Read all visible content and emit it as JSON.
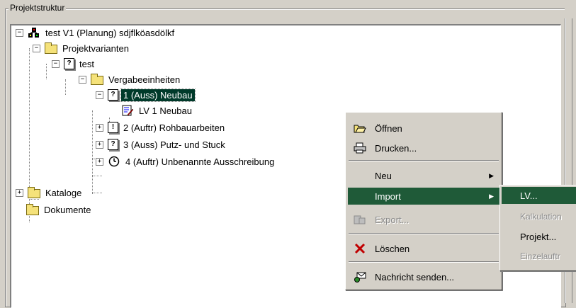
{
  "group_title": "Projektstruktur",
  "tree": {
    "root": "test V1 (Planung) sdjflköasdölkf",
    "projektvarianten": "Projektvarianten",
    "test": "test",
    "vergabeeinheiten": "Vergabeeinheiten",
    "item1": "1 (Auss) Neubau",
    "lv1": "LV 1 Neubau",
    "item2": "2 (Auftr) Rohbauarbeiten",
    "item3": "3 (Auss) Putz- und Stuck",
    "item4": "4 (Auftr) Unbenannte Ausschreibung",
    "kataloge": "Kataloge",
    "dokumente": "Dokumente"
  },
  "context_menu": {
    "oeffnen": "Öffnen",
    "drucken": "Drucken...",
    "neu": "Neu",
    "import": "Import",
    "export": "Export...",
    "loeschen": "Löschen",
    "nachricht": "Nachricht senden..."
  },
  "submenu": {
    "lv": "LV...",
    "kalkulation": "Kalkulation",
    "projekt": "Projekt...",
    "einzelauftr": "Einzelauftr"
  },
  "icons": {
    "root": "project-network-icon",
    "folder": "folder-icon",
    "question": "question-box-icon",
    "exclaim": "exclamation-box-icon",
    "clock": "clock-icon",
    "lv": "document-pencil-icon"
  },
  "colors": {
    "selection": "#003a2a",
    "menu_highlight": "#1f5a38",
    "window_bg": "#d4d0c8"
  }
}
